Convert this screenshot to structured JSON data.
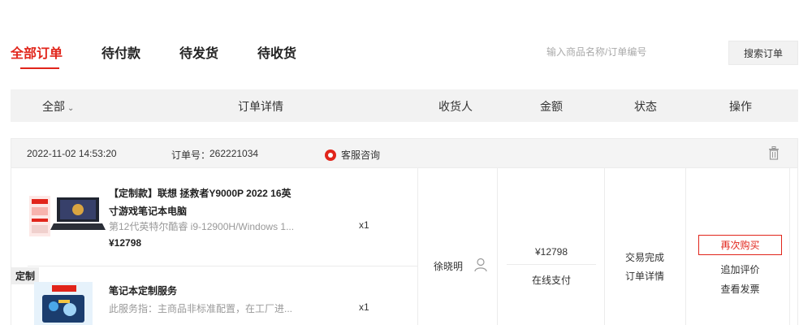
{
  "tabs": [
    {
      "label": "全部订单"
    },
    {
      "label": "待付款"
    },
    {
      "label": "待发货"
    },
    {
      "label": "待收货"
    }
  ],
  "search": {
    "placeholder": "输入商品名称/订单编号",
    "button_label": "搜索订单"
  },
  "header": {
    "filter_label": "全部",
    "col_detail": "订单详情",
    "col_receiver": "收货人",
    "col_amount": "金额",
    "col_status": "状态",
    "col_action": "操作"
  },
  "order": {
    "datetime": "2022-11-02 14:53:20",
    "order_no_label": "订单号：",
    "order_no": "262221034",
    "service_label": "客服咨询",
    "items": [
      {
        "title": "【定制款】联想 拯救者Y9000P 2022 16英寸游戏笔记本电脑",
        "subtitle": "第12代英特尔酷睿 i9-12900H/Windows 1...",
        "price": "¥12798",
        "qty": "x1"
      },
      {
        "title": "笔记本定制服务",
        "subtitle": "此服务指：主商品非标准配置，在工厂进...",
        "qty": "x1"
      }
    ],
    "custom_tag": "定制",
    "receiver": "徐晓明",
    "amount": "¥12798",
    "payment": "在线支付",
    "status": "交易完成",
    "detail_link": "订单详情",
    "rebuy_label": "再次购买",
    "review_label": "追加评价",
    "invoice_label": "查看发票"
  },
  "colors": {
    "accent": "#e1251b"
  }
}
